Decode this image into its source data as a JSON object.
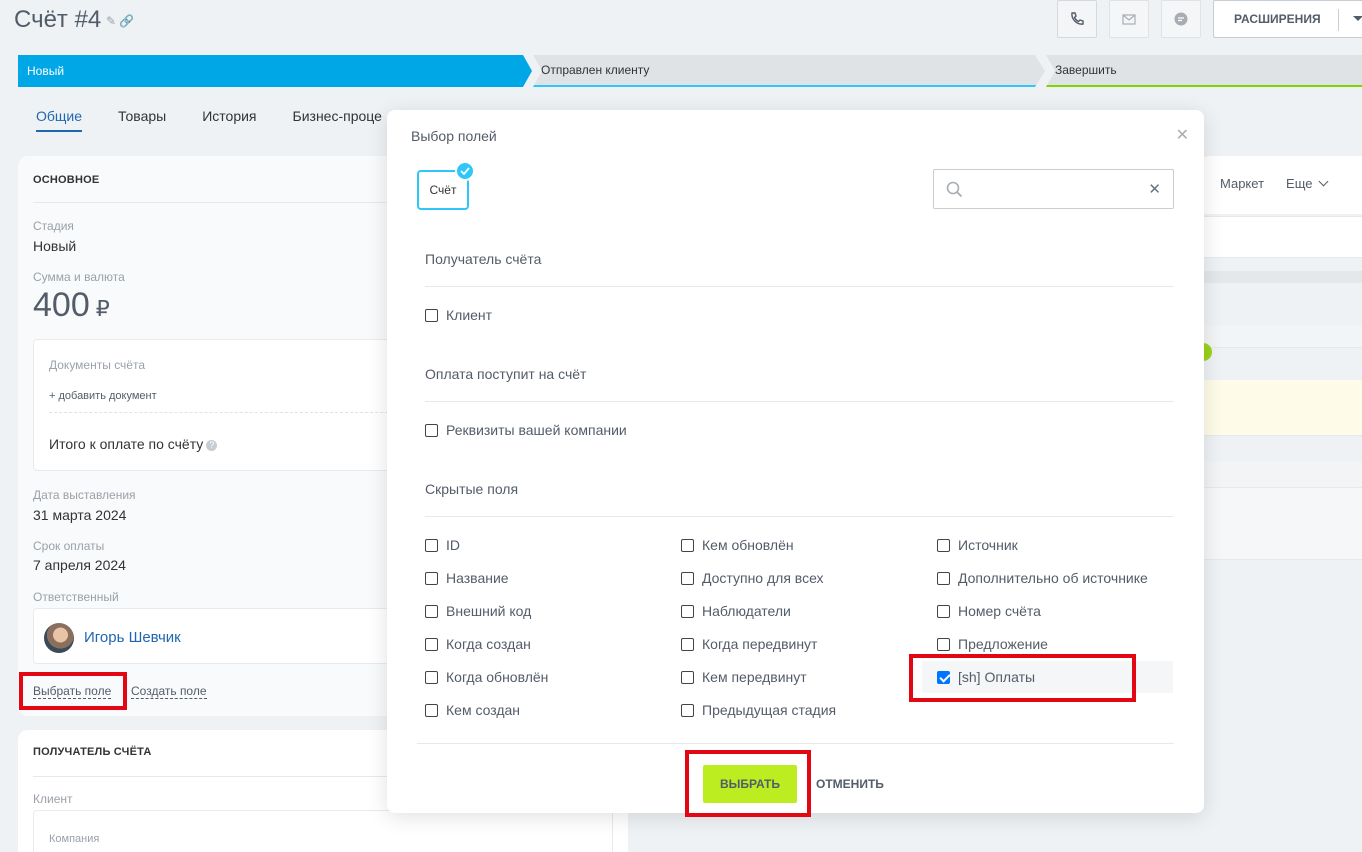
{
  "header": {
    "title": "Счёт #4",
    "extensions_label": "РАСШИРЕНИЯ"
  },
  "stages": [
    "Новый",
    "Отправлен клиенту",
    "Завершить"
  ],
  "tabs": [
    "Общие",
    "Товары",
    "История",
    "Бизнес-проце"
  ],
  "main": {
    "section_title": "ОСНОВНОЕ",
    "stage_label": "Стадия",
    "stage_value": "Новый",
    "sum_label": "Сумма и валюта",
    "sum_value": "400",
    "currency": "₽",
    "docs_label": "Документы счёта",
    "add_doc": "+ добавить документ",
    "total_label": "Итого к оплате по счёту",
    "issue_date_label": "Дата выставления",
    "issue_date": "31 марта 2024",
    "due_label": "Срок оплаты",
    "due_date": "7 апреля 2024",
    "responsible_label": "Ответственный",
    "responsible_name": "Игорь Шевчик",
    "choose_field": "Выбрать поле",
    "create_field": "Создать поле"
  },
  "recipient": {
    "section_title": "ПОЛУЧАТЕЛЬ СЧЁТА",
    "client_label": "Клиент",
    "company_label": "Компания"
  },
  "right_panel": {
    "market": "Маркет",
    "more": "Еще"
  },
  "modal": {
    "title": "Выбор полей",
    "chip_label": "Счёт",
    "search_placeholder": "",
    "group1": "Получатель счёта",
    "group1_items": [
      "Клиент"
    ],
    "group2": "Оплата поступит на счёт",
    "group2_items": [
      "Реквизиты вашей компании"
    ],
    "group3": "Скрытые поля",
    "col1": [
      "ID",
      "Название",
      "Внешний код",
      "Когда создан",
      "Когда обновлён",
      "Кем создан"
    ],
    "col2": [
      "Кем обновлён",
      "Доступно для всех",
      "Наблюдатели",
      "Когда передвинут",
      "Кем передвинут",
      "Предыдущая стадия"
    ],
    "col3": [
      "Источник",
      "Дополнительно об источнике",
      "Номер счёта",
      "Предложение",
      "[sh] Оплаты"
    ],
    "checked_item": "[sh] Оплаты",
    "ok_label": "ВЫБРАТЬ",
    "cancel_label": "ОТМЕНИТЬ"
  }
}
